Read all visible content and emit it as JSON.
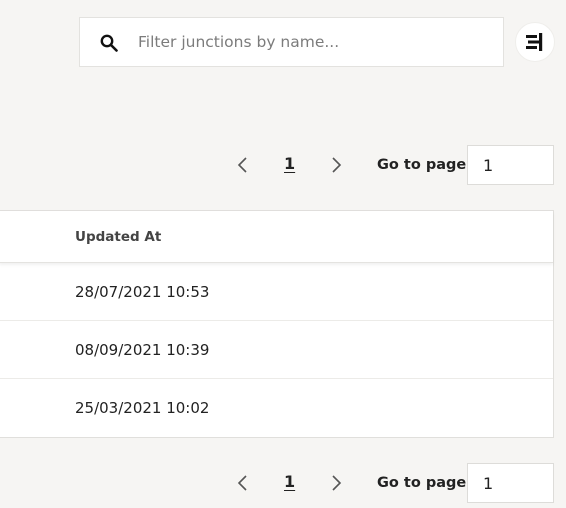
{
  "search": {
    "placeholder": "Filter junctions by name...",
    "value": ""
  },
  "icons": {
    "search": "search-icon",
    "filter": "filter-icon",
    "prev": "chevron-left-icon",
    "next": "chevron-right-icon"
  },
  "pagination": {
    "current_page": "1",
    "goto_label": "Go to page",
    "goto_value": "1"
  },
  "table": {
    "columns": [
      "Updated At"
    ],
    "rows": [
      [
        "28/07/2021 10:53"
      ],
      [
        "08/09/2021 10:39"
      ],
      [
        "25/03/2021 10:02"
      ]
    ]
  }
}
